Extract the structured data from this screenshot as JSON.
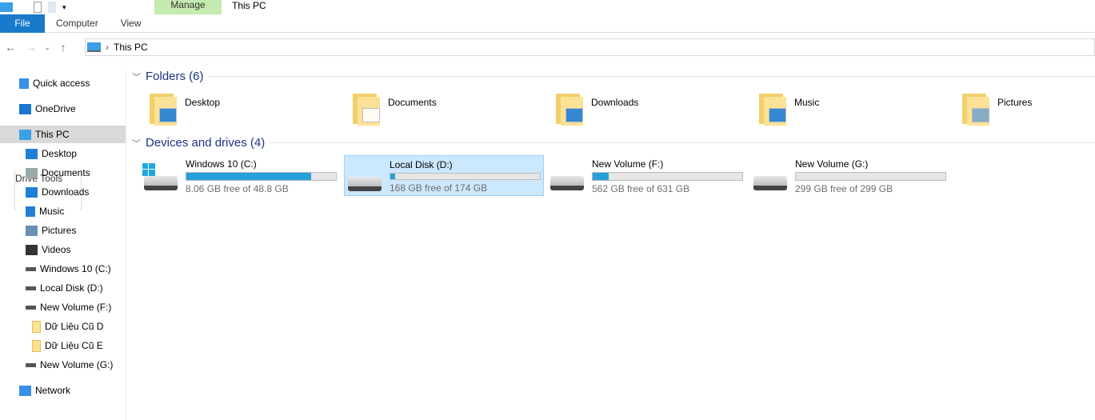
{
  "window": {
    "title": "This PC",
    "context_tab": "Manage"
  },
  "ribbon": {
    "tabs": [
      "File",
      "Computer",
      "View"
    ],
    "context": "Drive Tools"
  },
  "address": {
    "path": "This PC"
  },
  "sidebar": {
    "items": [
      {
        "label": "Quick access",
        "icon": "star-icon",
        "level": 0
      },
      {
        "label": "OneDrive",
        "icon": "cloud-icon",
        "level": 0
      },
      {
        "label": "This PC",
        "icon": "computer-icon",
        "level": 0,
        "selected": true
      },
      {
        "label": "Desktop",
        "icon": "desktop-icon",
        "level": 1
      },
      {
        "label": "Documents",
        "icon": "documents-icon",
        "level": 1
      },
      {
        "label": "Downloads",
        "icon": "download-icon",
        "level": 1
      },
      {
        "label": "Music",
        "icon": "music-icon",
        "level": 1
      },
      {
        "label": "Pictures",
        "icon": "pictures-icon",
        "level": 1
      },
      {
        "label": "Videos",
        "icon": "videos-icon",
        "level": 1
      },
      {
        "label": "Windows 10 (C:)",
        "icon": "drive-icon",
        "level": 1
      },
      {
        "label": "Local Disk (D:)",
        "icon": "drive-icon",
        "level": 1
      },
      {
        "label": "New Volume (F:)",
        "icon": "drive-icon",
        "level": 1
      },
      {
        "label": "Dữ Liệu Cũ D",
        "icon": "folder-icon",
        "level": 2
      },
      {
        "label": "Dữ Liệu Cũ E",
        "icon": "folder-icon",
        "level": 2
      },
      {
        "label": "New Volume (G:)",
        "icon": "drive-icon",
        "level": 1
      },
      {
        "label": "Network",
        "icon": "network-icon",
        "level": 0
      }
    ]
  },
  "folders": {
    "header": "Folders (6)",
    "items": [
      {
        "label": "Desktop",
        "overlay": "#1f7fd8"
      },
      {
        "label": "Documents",
        "overlay": "#ffffff"
      },
      {
        "label": "Downloads",
        "overlay": "#1f7fd8"
      },
      {
        "label": "Music",
        "overlay": "#1f7fd8"
      },
      {
        "label": "Pictures",
        "overlay": "#7aa6c9"
      }
    ]
  },
  "drives": {
    "header": "Devices and drives (4)",
    "items": [
      {
        "label": "Windows 10 (C:)",
        "free": "8.06 GB free of 48.8 GB",
        "used_fraction": 0.835,
        "system": true
      },
      {
        "label": "Local Disk (D:)",
        "free": "168 GB free of 174 GB",
        "used_fraction": 0.034,
        "selected": true
      },
      {
        "label": "New Volume (F:)",
        "free": "562 GB free of 631 GB",
        "used_fraction": 0.109
      },
      {
        "label": "New Volume (G:)",
        "free": "299 GB free of 299 GB",
        "used_fraction": 0.0
      }
    ]
  },
  "colors": {
    "accent": "#1979ca",
    "bar": "#26a0da",
    "selection": "#cce8ff"
  }
}
